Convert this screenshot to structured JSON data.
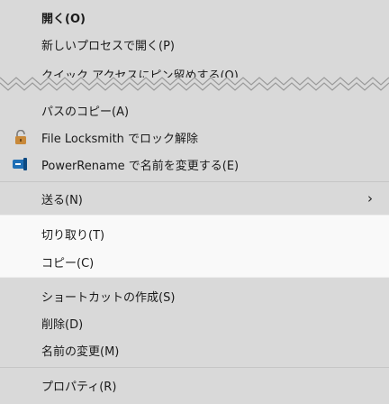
{
  "menu": {
    "items": [
      {
        "label": "開く(O)"
      },
      {
        "label": "新しいプロセスで開く(P)"
      },
      {
        "label": "クイック アクセスにピン留めする(Q)"
      },
      {
        "label": "パスのコピー(A)"
      },
      {
        "label": "File Locksmith でロック解除",
        "icon": "lock-icon"
      },
      {
        "label": "PowerRename で名前を変更する(E)",
        "icon": "powerrename-icon"
      },
      {
        "label": "送る(N)",
        "submenu_indicator": "›"
      },
      {
        "label": "切り取り(T)"
      },
      {
        "label": "コピー(C)"
      },
      {
        "label": "ショートカットの作成(S)"
      },
      {
        "label": "削除(D)"
      },
      {
        "label": "名前の変更(M)"
      },
      {
        "label": "プロパティ(R)"
      }
    ]
  },
  "colors": {
    "menu_background": "#d9d9d9",
    "highlight_background": "#f9f9f9",
    "separator": "#c6c6c6",
    "lock_icon": "#c8893a",
    "powerrename_icon": "#1f6fb5"
  }
}
